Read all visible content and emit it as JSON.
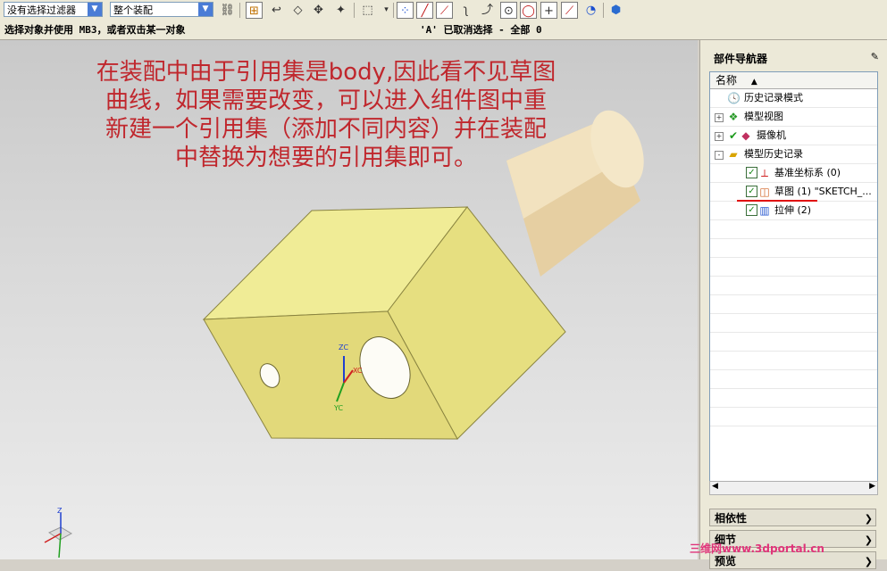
{
  "toolbar": {
    "filter_combo": "没有选择过滤器",
    "scope_combo": "整个装配",
    "icons": [
      "select-filter-icon",
      "snap-icon",
      "undo-icon",
      "eraser-icon",
      "select-icon",
      "move-icon",
      "box-select-icon",
      "snap-point-icon",
      "line-icon",
      "slash-icon",
      "curve-icon",
      "arc-icon",
      "circle-center-icon",
      "circle-icon",
      "plus-icon",
      "tangent-icon",
      "view-icon",
      "cube-icon"
    ]
  },
  "status": {
    "prompt": "选择对象并使用 MB3，或者双击某一对象",
    "message": "'A' 已取消选择 - 全部 0"
  },
  "annotation": {
    "lines": [
      "在装配中由于引用集是body,因此看不见草图",
      "曲线，如果需要改变，可以进入组件图中重",
      "新建一个引用集（添加不同内容）并在装配",
      "中替换为想要的引用集即可。"
    ]
  },
  "viewport": {
    "triad_labels": {
      "zc": "ZC",
      "yc": "YC",
      "xc": "XC"
    },
    "corner_triad_z": "Z"
  },
  "navigator": {
    "title": "部件导航器",
    "column_header": "名称",
    "items": [
      {
        "label": "历史记录模式",
        "icon": "clock-icon",
        "level": 0,
        "expander": ""
      },
      {
        "label": "模型视图",
        "icon": "model-views-icon",
        "level": 0,
        "expander": "+"
      },
      {
        "label": "摄像机",
        "icon": "camera-icon",
        "level": 0,
        "expander": "+"
      },
      {
        "label": "模型历史记录",
        "icon": "folder-icon",
        "level": 0,
        "expander": "-"
      },
      {
        "label": "基准坐标系 (0)",
        "icon": "datum-csys-icon",
        "level": 1,
        "checked": true
      },
      {
        "label": "草图 (1) \"SKETCH_...",
        "icon": "sketch-icon",
        "level": 1,
        "checked": true
      },
      {
        "label": "拉伸 (2)",
        "icon": "extrude-icon",
        "level": 1,
        "checked": true
      }
    ],
    "sections": [
      "相依性",
      "细节",
      "预览"
    ]
  },
  "watermark": "三维网www.3dportal.cn",
  "colors": {
    "annotation": "#c0272d",
    "model_face": "#f0ec96",
    "underline": "#e01010"
  }
}
